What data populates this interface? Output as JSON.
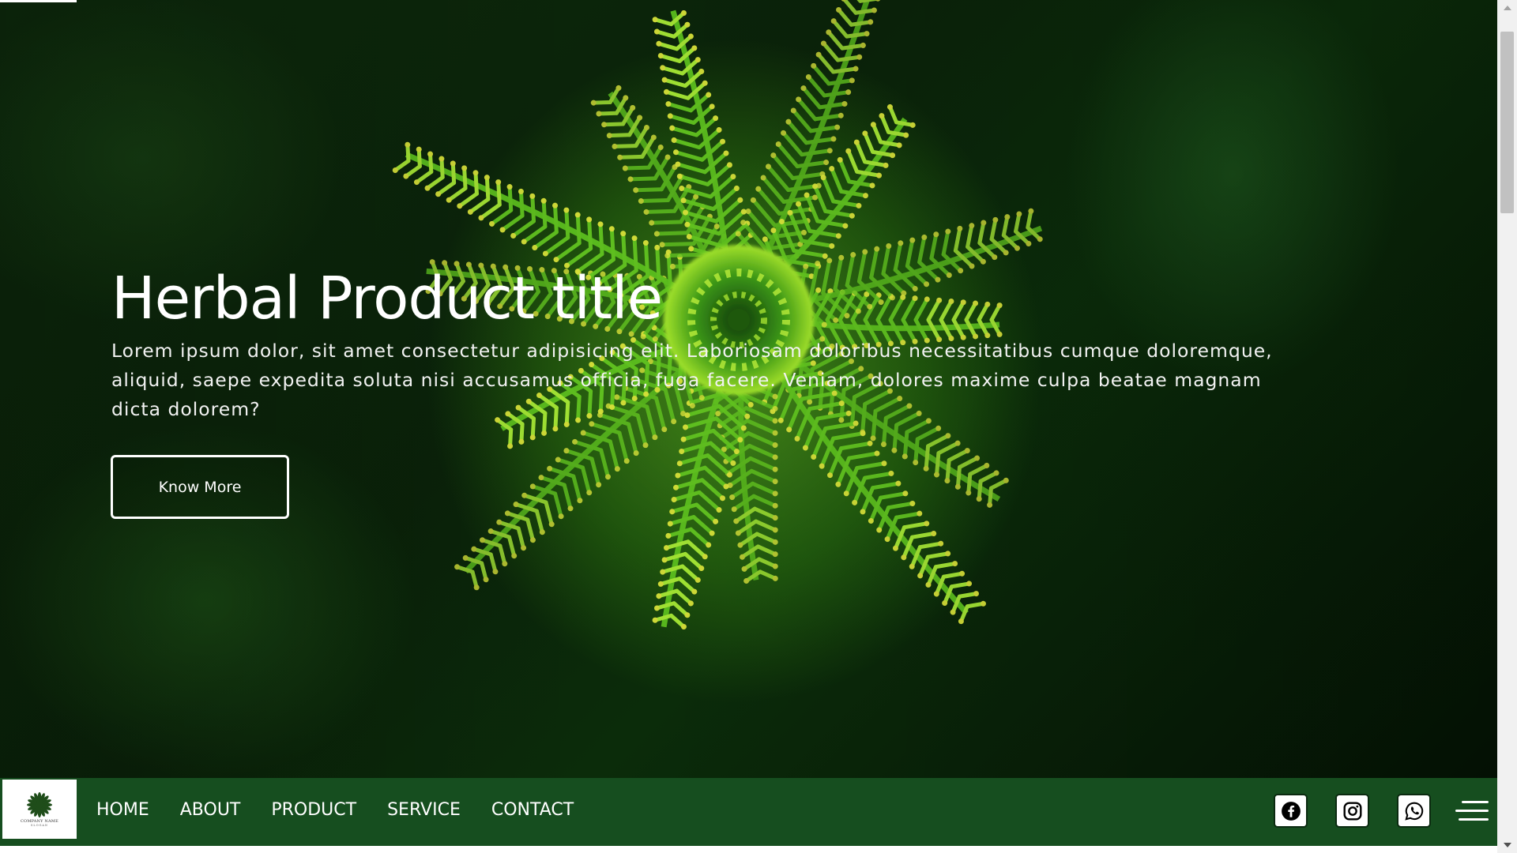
{
  "hero": {
    "title": "Herbal Product title",
    "text": "Lorem ipsum dolor, sit amet consectetur adipisicing elit. Laboriosam doloribus necessitatibus cumque doloremque, aliquid, saepe expedita soluta nisi accusamus officia, fuga facere. Veniam, dolores maxime culpa beatae magnam dicta dolorem?",
    "button_label": "Know More",
    "background_image": "green-fern-plant-closeup"
  },
  "navbar": {
    "logo": {
      "name": "COMPANY NAME",
      "tagline": "SLOGAN"
    },
    "links": [
      "HOME",
      "ABOUT",
      "PRODUCT",
      "SERVICE",
      "CONTACT"
    ],
    "social": [
      {
        "icon": "facebook-icon"
      },
      {
        "icon": "instagram-icon"
      },
      {
        "icon": "whatsapp-icon"
      }
    ],
    "menu_icon": "hamburger-menu-icon"
  },
  "colors": {
    "navbar_bg": "#164e1f",
    "hero_text": "#ffffff",
    "accent": "#3fa02a"
  }
}
